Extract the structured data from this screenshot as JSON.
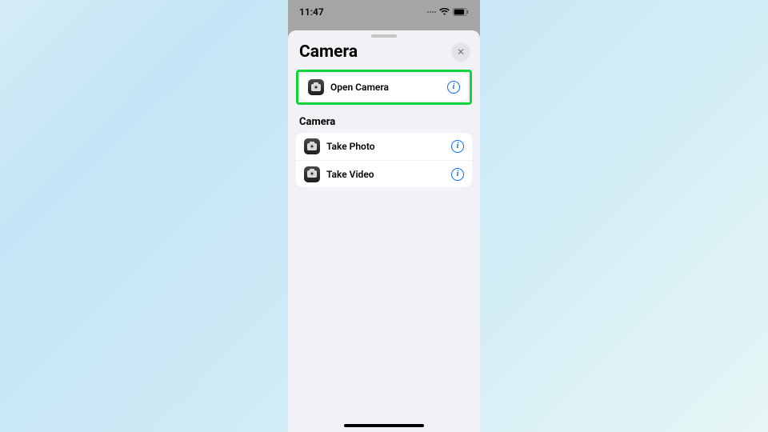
{
  "statusBar": {
    "time": "11:47"
  },
  "sheet": {
    "title": "Camera",
    "closeGlyph": "✕"
  },
  "highlighted": {
    "label": "Open Camera",
    "infoGlyph": "i"
  },
  "section": {
    "title": "Camera",
    "items": [
      {
        "label": "Take Photo",
        "infoGlyph": "i"
      },
      {
        "label": "Take Video",
        "infoGlyph": "i"
      }
    ]
  }
}
